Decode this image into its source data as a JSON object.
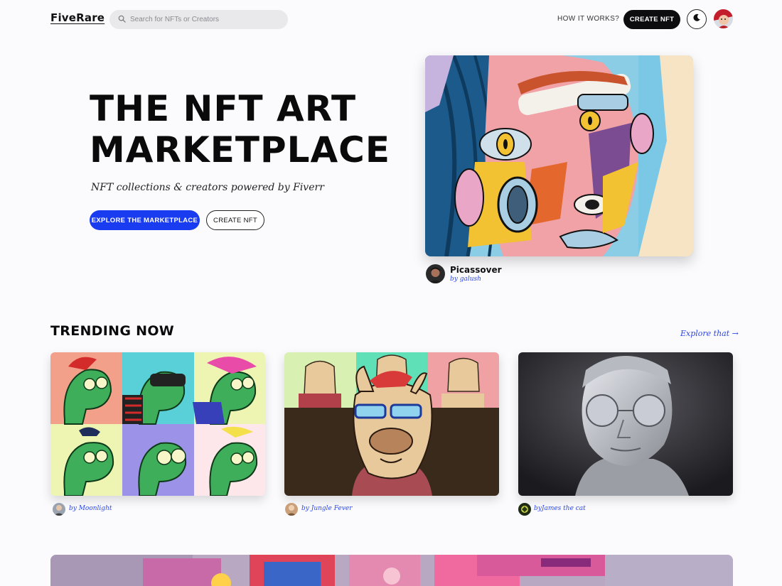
{
  "header": {
    "logo": "FiveRare",
    "search_placeholder": "Search for NFTs or Creators",
    "how_it_works": "HOW IT WORKS?",
    "create_nft": "CREATE NFT"
  },
  "hero": {
    "title_line1": "THE NFT ART",
    "title_line2": "MARKETPLACE",
    "subtitle": "NFT collections & creators powered by Fiverr",
    "explore_button": "EXPLORE THE MARKETPLACE",
    "create_button": "CREATE NFT",
    "featured": {
      "title": "Picassover",
      "author": "by galush"
    }
  },
  "trending": {
    "title": "TRENDING NOW",
    "explore_link": "Explore that →",
    "cards": [
      {
        "author": "by Moonlight"
      },
      {
        "author": "by Jungle Fever"
      },
      {
        "author": "byJames the cat"
      }
    ]
  }
}
